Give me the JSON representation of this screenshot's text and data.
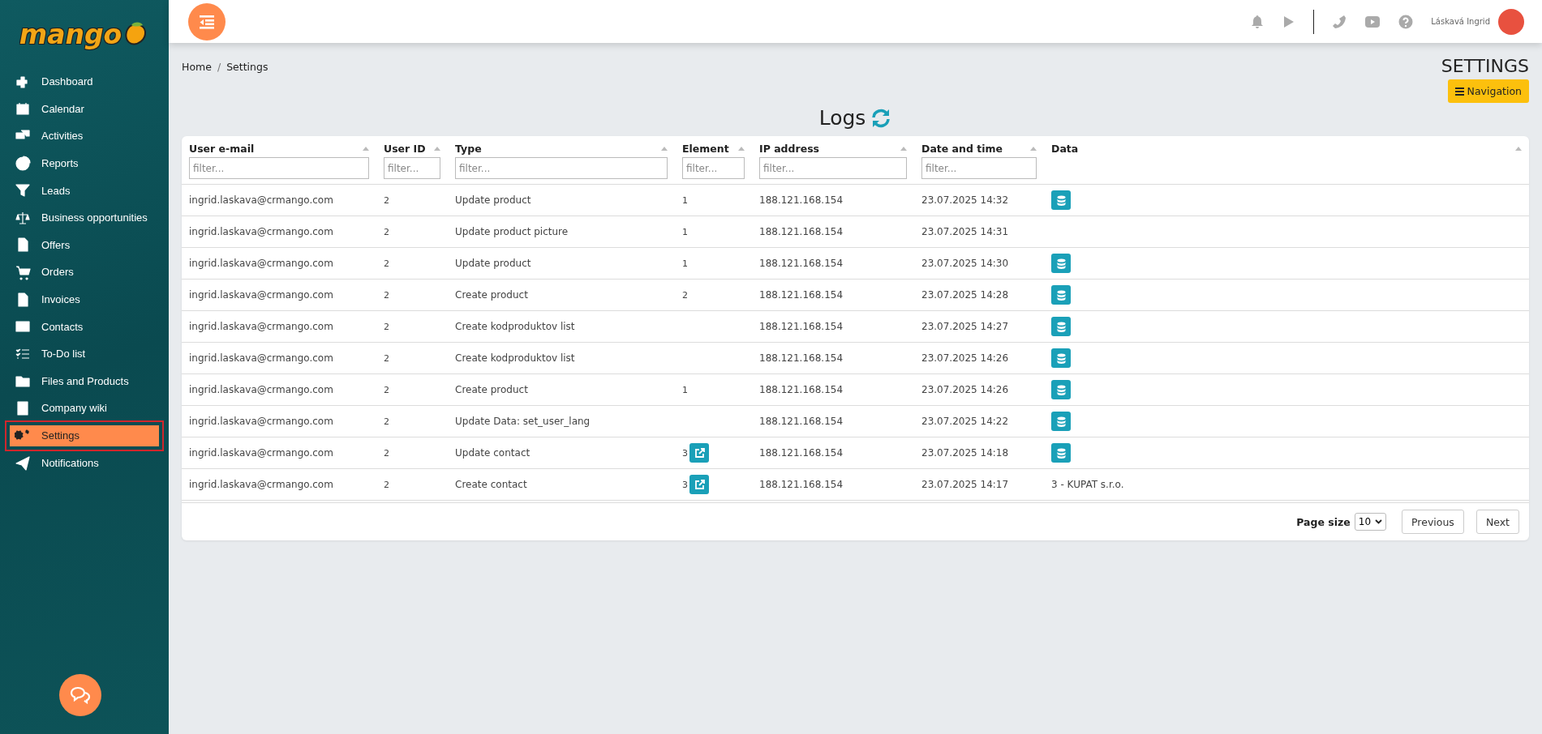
{
  "sidebar": {
    "logo": "mango",
    "items": [
      {
        "label": "Dashboard",
        "selected": false
      },
      {
        "label": "Calendar",
        "selected": false
      },
      {
        "label": "Activities",
        "selected": false
      },
      {
        "label": "Reports",
        "selected": false
      },
      {
        "label": "Leads",
        "selected": false
      },
      {
        "label": "Business opportunities",
        "selected": false
      },
      {
        "label": "Offers",
        "selected": false
      },
      {
        "label": "Orders",
        "selected": false
      },
      {
        "label": "Invoices",
        "selected": false
      },
      {
        "label": "Contacts",
        "selected": false
      },
      {
        "label": "To-Do list",
        "selected": false
      },
      {
        "label": "Files and Products",
        "selected": false
      },
      {
        "label": "Company wiki",
        "selected": false
      },
      {
        "label": "Settings",
        "selected": true
      },
      {
        "label": "Notifications",
        "selected": false
      }
    ]
  },
  "topbar": {
    "user_name": "Láskavá Ingrid"
  },
  "breadcrumb": {
    "items": [
      "Home",
      "Settings"
    ],
    "separator": "/"
  },
  "page_title": "SETTINGS",
  "navigation_button": "Navigation",
  "section_title": "Logs",
  "table": {
    "columns": [
      {
        "label": "User e-mail",
        "filter_placeholder": "filter..."
      },
      {
        "label": "User ID",
        "filter_placeholder": "filter..."
      },
      {
        "label": "Type",
        "filter_placeholder": "filter..."
      },
      {
        "label": "Element",
        "filter_placeholder": "filter..."
      },
      {
        "label": "IP address",
        "filter_placeholder": "filter..."
      },
      {
        "label": "Date and time",
        "filter_placeholder": "filter..."
      },
      {
        "label": "Data"
      }
    ],
    "rows": [
      {
        "email": "ingrid.laskava@crmango.com",
        "user_id": "2",
        "type": "Update product",
        "element": "1",
        "element_link": false,
        "ip": "188.121.168.154",
        "datetime": "23.07.2025 14:32",
        "data": {
          "kind": "icon"
        }
      },
      {
        "email": "ingrid.laskava@crmango.com",
        "user_id": "2",
        "type": "Update product picture",
        "element": "1",
        "element_link": false,
        "ip": "188.121.168.154",
        "datetime": "23.07.2025 14:31"
      },
      {
        "email": "ingrid.laskava@crmango.com",
        "user_id": "2",
        "type": "Update product",
        "element": "1",
        "element_link": false,
        "ip": "188.121.168.154",
        "datetime": "23.07.2025 14:30",
        "data": {
          "kind": "icon"
        }
      },
      {
        "email": "ingrid.laskava@crmango.com",
        "user_id": "2",
        "type": "Create product",
        "element": "2",
        "element_link": false,
        "ip": "188.121.168.154",
        "datetime": "23.07.2025 14:28",
        "data": {
          "kind": "icon"
        }
      },
      {
        "email": "ingrid.laskava@crmango.com",
        "user_id": "2",
        "type": "Create kodproduktov list",
        "element_link": false,
        "ip": "188.121.168.154",
        "datetime": "23.07.2025 14:27",
        "data": {
          "kind": "icon"
        }
      },
      {
        "email": "ingrid.laskava@crmango.com",
        "user_id": "2",
        "type": "Create kodproduktov list",
        "element_link": false,
        "ip": "188.121.168.154",
        "datetime": "23.07.2025 14:26",
        "data": {
          "kind": "icon"
        }
      },
      {
        "email": "ingrid.laskava@crmango.com",
        "user_id": "2",
        "type": "Create product",
        "element": "1",
        "element_link": false,
        "ip": "188.121.168.154",
        "datetime": "23.07.2025 14:26",
        "data": {
          "kind": "icon"
        }
      },
      {
        "email": "ingrid.laskava@crmango.com",
        "user_id": "2",
        "type": "Update Data: set_user_lang",
        "element_link": false,
        "ip": "188.121.168.154",
        "datetime": "23.07.2025 14:22",
        "data": {
          "kind": "icon"
        }
      },
      {
        "email": "ingrid.laskava@crmango.com",
        "user_id": "2",
        "type": "Update contact",
        "element": "3",
        "element_link": true,
        "ip": "188.121.168.154",
        "datetime": "23.07.2025 14:18",
        "data": {
          "kind": "icon"
        }
      },
      {
        "email": "ingrid.laskava@crmango.com",
        "user_id": "2",
        "type": "Create contact",
        "element": "3",
        "element_link": true,
        "ip": "188.121.168.154",
        "datetime": "23.07.2025 14:17",
        "data": {
          "kind": "text",
          "text": "3 - KUPAT s.r.o."
        }
      }
    ]
  },
  "pagination": {
    "page_size_label": "Page size",
    "page_size": "10",
    "previous": "Previous",
    "next": "Next"
  }
}
